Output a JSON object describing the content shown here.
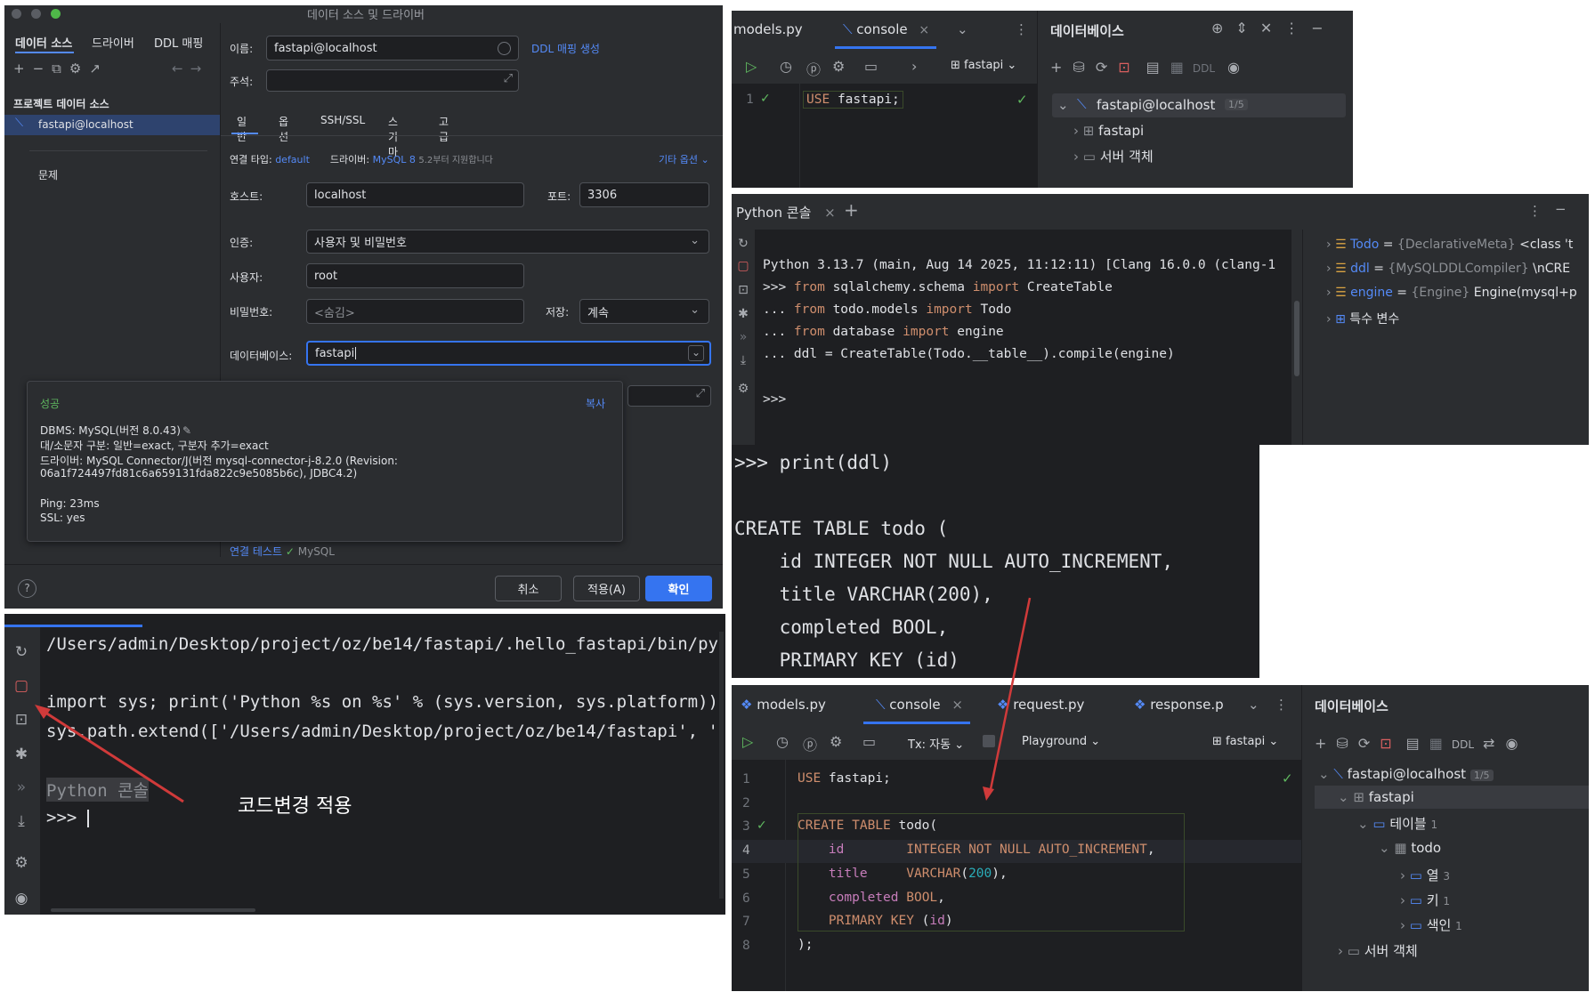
{
  "dialog": {
    "title": "데이터 소스 및 드라이버",
    "top_tabs": [
      "데이터 소스",
      "드라이버",
      "DDL 매핑"
    ],
    "section_title": "프로젝트 데이터 소스",
    "datasource_item": "fastapi@localhost",
    "problems_label": "문제",
    "name_label": "이름:",
    "name_value": "fastapi@localhost",
    "ddl_mapping_link": "DDL 매핑 생성",
    "comment_label": "주석:",
    "sub_tabs": [
      "일반",
      "옵션",
      "SSH/SSL",
      "스키마",
      "고급"
    ],
    "conn_type_label": "연결 타입:",
    "conn_type_value": "default",
    "driver_label": "드라이버:",
    "driver_value": "MySQL 8",
    "driver_note": "5.2부터 지원합니다",
    "more_options": "기타 옵션",
    "host_label": "호스트:",
    "host_value": "localhost",
    "port_label": "포트:",
    "port_value": "3306",
    "auth_label": "인증:",
    "auth_value": "사용자 및 비밀번호",
    "user_label": "사용자:",
    "user_value": "root",
    "password_label": "비밀번호:",
    "password_placeholder": "<숨김>",
    "save_label": "저장:",
    "save_value": "계속",
    "database_label": "데이터베이스:",
    "database_value": "fastapi",
    "popup": {
      "title": "성공",
      "copy": "복사",
      "line1": "DBMS: MySQL(버전 8.0.43)",
      "line2": "대/소문자 구분: 일반=exact, 구분자 추가=exact",
      "line3": "드라이버: MySQL Connector/J(버전 mysql-connector-j-8.2.0 (Revision:",
      "line4": "06a1f724497fd81c6a659131fda822c9e5085b6c), JDBC4.2)",
      "line5": "Ping: 23ms",
      "line6": "SSL: yes"
    },
    "test_conn": "연결 테스트",
    "test_conn_db": "MySQL",
    "cancel": "취소",
    "apply": "적용(A)",
    "ok": "확인",
    "help": "?"
  },
  "console_top": {
    "tabs": [
      "models.py",
      "console"
    ],
    "schema": "fastapi",
    "line_no": "1",
    "code": "USE fastapi;",
    "db_panel_title": "데이터베이스",
    "tree": [
      "fastapi@localhost",
      "1/5",
      "fastapi",
      "서버 객체"
    ]
  },
  "python_console": {
    "tab": "Python 콘솔",
    "lines": [
      "Python 3.13.7 (main, Aug 14 2025, 11:12:11) [Clang 16.0.0 (clang-1",
      ">>> from sqlalchemy.schema import CreateTable",
      "... from todo.models import Todo",
      "... from database import engine",
      "... ddl = CreateTable(Todo.__table__).compile(engine)",
      ">>>"
    ],
    "vars": [
      {
        "name": "Todo",
        "type": "{DeclarativeMeta}",
        "value": "<class 't"
      },
      {
        "name": "ddl",
        "type": "{MySQLDDLCompiler}",
        "value": "\\nCRE"
      },
      {
        "name": "engine",
        "type": "{Engine}",
        "value": "Engine(mysql+p"
      },
      {
        "name": "특수 변수",
        "type": "",
        "value": ""
      }
    ]
  },
  "ddl_output": {
    "lines": [
      ">>> print(ddl)",
      "",
      "CREATE TABLE todo (",
      "    id INTEGER NOT NULL AUTO_INCREMENT,",
      "    title VARCHAR(200),",
      "    completed BOOL,",
      "    PRIMARY KEY (id)"
    ]
  },
  "terminal": {
    "lines": [
      "/Users/admin/Desktop/project/oz/be14/fastapi/.hello_fastapi/bin/py",
      "",
      "import sys; print('Python %s on %s' % (sys.version, sys.platform))",
      "sys.path.extend(['/Users/admin/Desktop/project/oz/be14/fastapi', '"
    ],
    "console_label": "Python 콘솔",
    "prompt": ">>>",
    "annotation": "코드변경 적용"
  },
  "console_bottom": {
    "tabs": [
      "models.py",
      "console",
      "request.py",
      "response.p"
    ],
    "tx": "Tx: 자동",
    "playground": "Playground",
    "schema": "fastapi",
    "db_panel_title": "데이터베이스",
    "tree": {
      "root": "fastapi@localhost",
      "root_count": "1/5",
      "schema": "fastapi",
      "tables": "테이블",
      "tables_count": "1",
      "todo": "todo",
      "cols": "열",
      "cols_count": "3",
      "keys": "키",
      "keys_count": "1",
      "indexes": "색인",
      "indexes_count": "1",
      "server": "서버 객체"
    }
  },
  "colors": {
    "accent": "#548af7",
    "keyword": "#cf8e6d",
    "function": "#56a8f5",
    "number": "#2aacb8",
    "field": "#c77dbb",
    "success": "#5fb85f",
    "annotation_arrow": "#d03a3a"
  }
}
